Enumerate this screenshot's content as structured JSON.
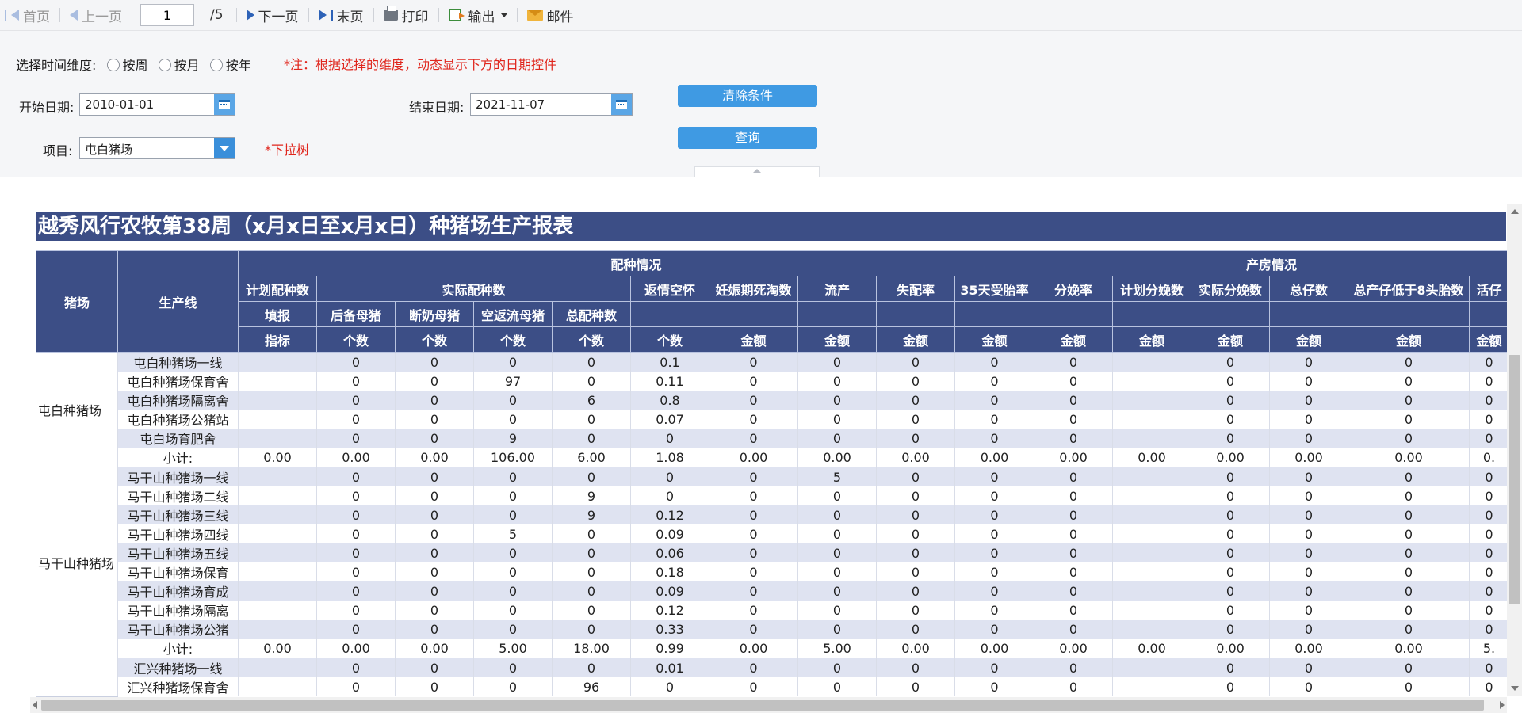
{
  "toolbar": {
    "first": "首页",
    "prev": "上一页",
    "page_value": "1",
    "total": "/5",
    "next": "下一页",
    "last": "末页",
    "print": "打印",
    "export": "输出",
    "mail": "邮件"
  },
  "params": {
    "time_label": "选择时间维度:",
    "radio_week": "按周",
    "radio_month": "按月",
    "radio_year": "按年",
    "note_date": "*注：根据选择的维度，动态显示下方的日期控件",
    "start_label": "开始日期:",
    "start_value": "2010-01-01",
    "end_label": "结束日期:",
    "end_value": "2021-11-07",
    "project_label": "项目:",
    "project_value": "屯白猪场",
    "note_tree": "*下拉树",
    "clear_button": "清除条件",
    "query_button": "查询"
  },
  "report": {
    "title": "越秀风行农牧第38周（x月x日至x月x日）种猪场生产报表",
    "headers": {
      "farm": "猪场",
      "line": "生产线",
      "breeding": "配种情况",
      "farrowing": "产房情况",
      "plan_breed": "计划配种数",
      "actual_breed": "实际配种数",
      "return_empty": "返情空怀",
      "preg_death": "妊娠期死淘数",
      "abortion": "流产",
      "fail_rate": "失配率",
      "conc_35": "35天受胎率",
      "farrow_rate": "分娩率",
      "plan_farrow": "计划分娩数",
      "actual_farrow": "实际分娩数",
      "total_piglets": "总仔数",
      "low_litters": "总产仔低于8头胎数",
      "live_piglets": "活仔",
      "fill": "填报",
      "gilt": "后备母猪",
      "weaned_sow": "断奶母猪",
      "return_sow": "空返流母猪",
      "total_breed": "总配种数",
      "index": "指标",
      "count": "个数",
      "amount": "金额"
    },
    "groups": [
      {
        "farm": "屯白种猪场",
        "rows": [
          {
            "line": "屯白种猪场一线",
            "v": [
              "",
              "0",
              "0",
              "0",
              "0",
              "0.1",
              "0",
              "0",
              "0",
              "0",
              "0",
              "",
              "0",
              "0",
              "0",
              "0"
            ]
          },
          {
            "line": "屯白种猪场保育舍",
            "v": [
              "",
              "0",
              "0",
              "97",
              "0",
              "0.11",
              "0",
              "0",
              "0",
              "0",
              "0",
              "",
              "0",
              "0",
              "0",
              "0"
            ]
          },
          {
            "line": "屯白种猪场隔离舍",
            "v": [
              "",
              "0",
              "0",
              "0",
              "6",
              "0.8",
              "0",
              "0",
              "0",
              "0",
              "0",
              "",
              "0",
              "0",
              "0",
              "0"
            ]
          },
          {
            "line": "屯白种猪场公猪站",
            "v": [
              "",
              "0",
              "0",
              "0",
              "0",
              "0.07",
              "0",
              "0",
              "0",
              "0",
              "0",
              "",
              "0",
              "0",
              "0",
              "0"
            ]
          },
          {
            "line": "屯白场育肥舍",
            "v": [
              "",
              "0",
              "0",
              "9",
              "0",
              "0",
              "0",
              "0",
              "0",
              "0",
              "0",
              "",
              "0",
              "0",
              "0",
              "0"
            ]
          }
        ],
        "subtotal": {
          "label": "小计:",
          "v": [
            "0.00",
            "0.00",
            "0.00",
            "106.00",
            "6.00",
            "1.08",
            "0.00",
            "0.00",
            "0.00",
            "0.00",
            "0.00",
            "0.00",
            "0.00",
            "0.00",
            "0.00",
            "0."
          ]
        }
      },
      {
        "farm": "马干山种猪场",
        "rows": [
          {
            "line": "马干山种猪场一线",
            "v": [
              "",
              "0",
              "0",
              "0",
              "0",
              "0",
              "0",
              "5",
              "0",
              "0",
              "0",
              "",
              "0",
              "0",
              "0",
              "0"
            ]
          },
          {
            "line": "马干山种猪场二线",
            "v": [
              "",
              "0",
              "0",
              "0",
              "9",
              "0",
              "0",
              "0",
              "0",
              "0",
              "0",
              "",
              "0",
              "0",
              "0",
              "0"
            ]
          },
          {
            "line": "马干山种猪场三线",
            "v": [
              "",
              "0",
              "0",
              "0",
              "9",
              "0.12",
              "0",
              "0",
              "0",
              "0",
              "0",
              "",
              "0",
              "0",
              "0",
              "0"
            ]
          },
          {
            "line": "马干山种猪场四线",
            "v": [
              "",
              "0",
              "0",
              "5",
              "0",
              "0.09",
              "0",
              "0",
              "0",
              "0",
              "0",
              "",
              "0",
              "0",
              "0",
              "0"
            ]
          },
          {
            "line": "马干山种猪场五线",
            "v": [
              "",
              "0",
              "0",
              "0",
              "0",
              "0.06",
              "0",
              "0",
              "0",
              "0",
              "0",
              "",
              "0",
              "0",
              "0",
              "0"
            ]
          },
          {
            "line": "马干山种猪场保育",
            "v": [
              "",
              "0",
              "0",
              "0",
              "0",
              "0.18",
              "0",
              "0",
              "0",
              "0",
              "0",
              "",
              "0",
              "0",
              "0",
              "0"
            ]
          },
          {
            "line": "马干山种猪场育成",
            "v": [
              "",
              "0",
              "0",
              "0",
              "0",
              "0.09",
              "0",
              "0",
              "0",
              "0",
              "0",
              "",
              "0",
              "0",
              "0",
              "0"
            ]
          },
          {
            "line": "马干山种猪场隔离",
            "v": [
              "",
              "0",
              "0",
              "0",
              "0",
              "0.12",
              "0",
              "0",
              "0",
              "0",
              "0",
              "",
              "0",
              "0",
              "0",
              "0"
            ]
          },
          {
            "line": "马干山种猪场公猪",
            "v": [
              "",
              "0",
              "0",
              "0",
              "0",
              "0.33",
              "0",
              "0",
              "0",
              "0",
              "0",
              "",
              "0",
              "0",
              "0",
              "0"
            ]
          }
        ],
        "subtotal": {
          "label": "小计:",
          "v": [
            "0.00",
            "0.00",
            "0.00",
            "5.00",
            "18.00",
            "0.99",
            "0.00",
            "5.00",
            "0.00",
            "0.00",
            "0.00",
            "0.00",
            "0.00",
            "0.00",
            "0.00",
            "5."
          ]
        }
      },
      {
        "farm": "",
        "rows": [
          {
            "line": "汇兴种猪场一线",
            "v": [
              "",
              "0",
              "0",
              "0",
              "0",
              "0.01",
              "0",
              "0",
              "0",
              "0",
              "0",
              "",
              "0",
              "0",
              "0",
              "0"
            ]
          },
          {
            "line": "汇兴种猪场保育舍",
            "v": [
              "",
              "0",
              "0",
              "0",
              "96",
              "0",
              "0",
              "0",
              "0",
              "0",
              "0",
              "",
              "0",
              "0",
              "0",
              "0"
            ]
          }
        ]
      }
    ]
  }
}
